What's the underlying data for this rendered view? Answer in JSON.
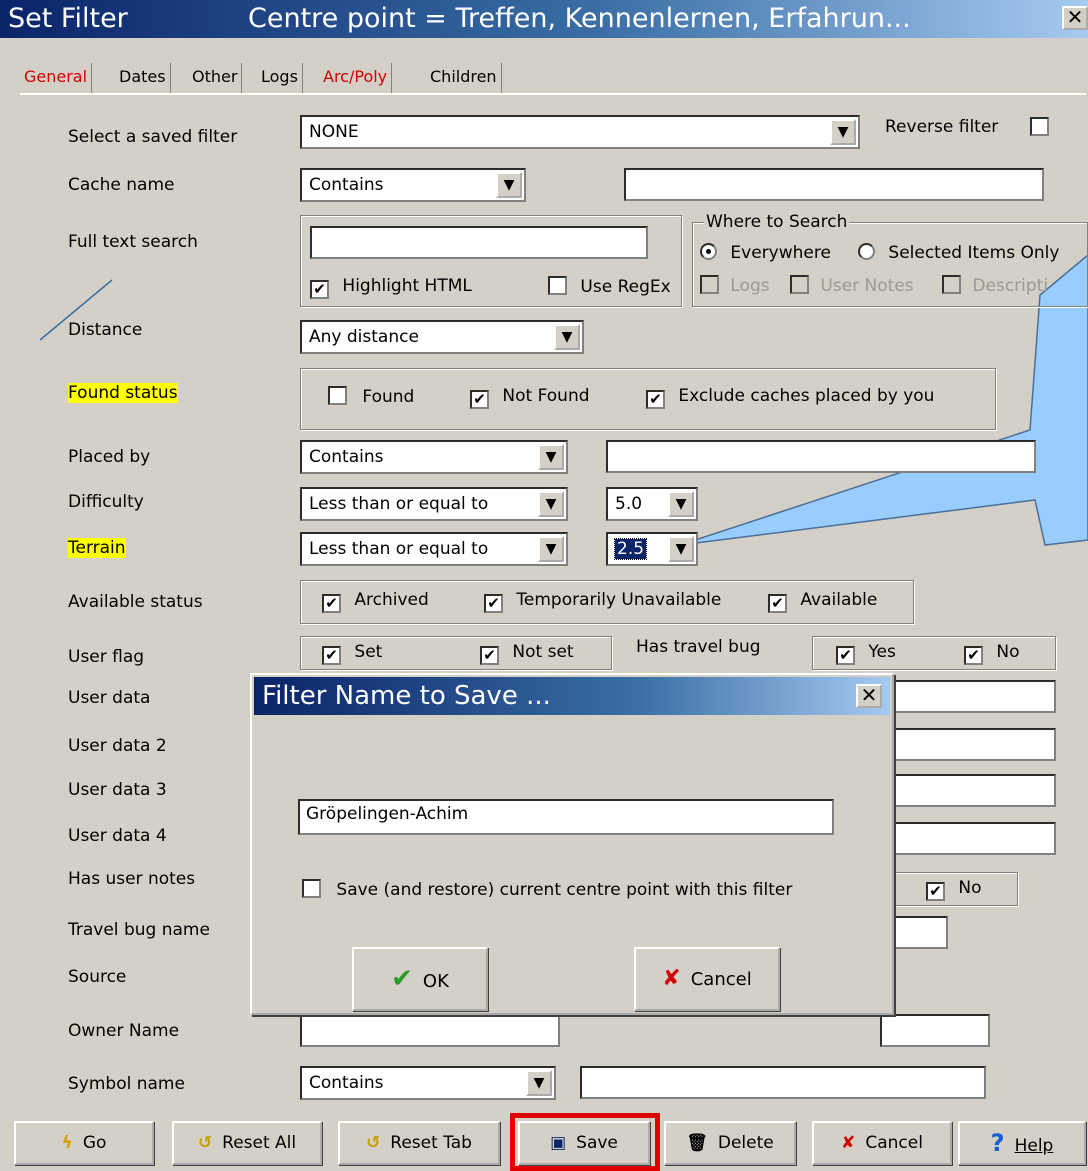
{
  "window": {
    "title": "Set Filter",
    "centre_point": "Centre point = Treffen, Kennenlernen, Erfahrun...",
    "close_glyph": "✕"
  },
  "tabs": [
    "General",
    "Dates",
    "Other",
    "Logs",
    "Arc/Poly",
    "Children"
  ],
  "labels": {
    "saved_filter": "Select a saved filter",
    "cache_name": "Cache name",
    "full_text": "Full text search",
    "distance": "Distance",
    "found_status": "Found status",
    "placed_by": "Placed by",
    "difficulty": "Difficulty",
    "terrain": "Terrain",
    "available_status": "Available status",
    "user_flag": "User flag",
    "user_data": "User data",
    "user_data_2": "User data 2",
    "user_data_3": "User data 3",
    "user_data_4": "User data 4",
    "has_user_notes": "Has user notes",
    "travel_bug_name": "Travel bug name",
    "source": "Source",
    "owner_name": "Owner Name",
    "symbol_name": "Symbol name",
    "has_travel_bug": "Has travel bug"
  },
  "fields": {
    "saved_filter": "NONE",
    "reverse_filter": "Reverse filter",
    "cache_name_mode": "Contains",
    "distance": "Any distance",
    "placed_by_mode": "Contains",
    "difficulty_mode": "Less than or equal to",
    "difficulty_value": "5.0",
    "terrain_mode": "Less than or equal to",
    "terrain_value": "2.5",
    "symbol_mode": "Contains"
  },
  "fulltext": {
    "highlight_html": "Highlight HTML",
    "use_regex": "Use RegEx"
  },
  "where_to_search": {
    "title": "Where to Search",
    "everywhere": "Everywhere",
    "selected_only": "Selected Items Only",
    "logs": "Logs",
    "user_notes": "User Notes",
    "description": "Descripti"
  },
  "found": {
    "found": "Found",
    "not_found": "Not Found",
    "exclude": "Exclude caches placed by you"
  },
  "available": {
    "archived": "Archived",
    "temp_unavailable": "Temporarily Unavailable",
    "available": "Available"
  },
  "user_flag": {
    "set": "Set",
    "not_set": "Not set"
  },
  "travel_bug": {
    "yes": "Yes",
    "no": "No"
  },
  "user_notes_no": "No",
  "check_mark": "✔",
  "dialog": {
    "title": "Filter Name to Save ...",
    "name_value": "Gröpelingen-Achim",
    "save_centre": "Save (and restore) current centre point with this filter",
    "ok": "OK",
    "cancel": "Cancel",
    "ok_icon": "✔",
    "cancel_icon": "✘",
    "close_glyph": "✕"
  },
  "buttons": {
    "go": "Go",
    "reset_all": "Reset All",
    "reset_tab": "Reset Tab",
    "save": "Save",
    "delete": "Delete",
    "cancel": "Cancel",
    "help": "Help"
  },
  "icons": {
    "go": "lightning-icon",
    "reset": "reset-icon",
    "save": "floppy-disk-icon",
    "delete": "trash-icon",
    "cancel": "red-x-icon",
    "help": "question-icon",
    "dropdown": "chevron-down-icon"
  },
  "colors": {
    "highlight": "#ffff00",
    "active_tab": "#d40000",
    "callout": "#99ccff",
    "save_outline": "#e00000"
  }
}
